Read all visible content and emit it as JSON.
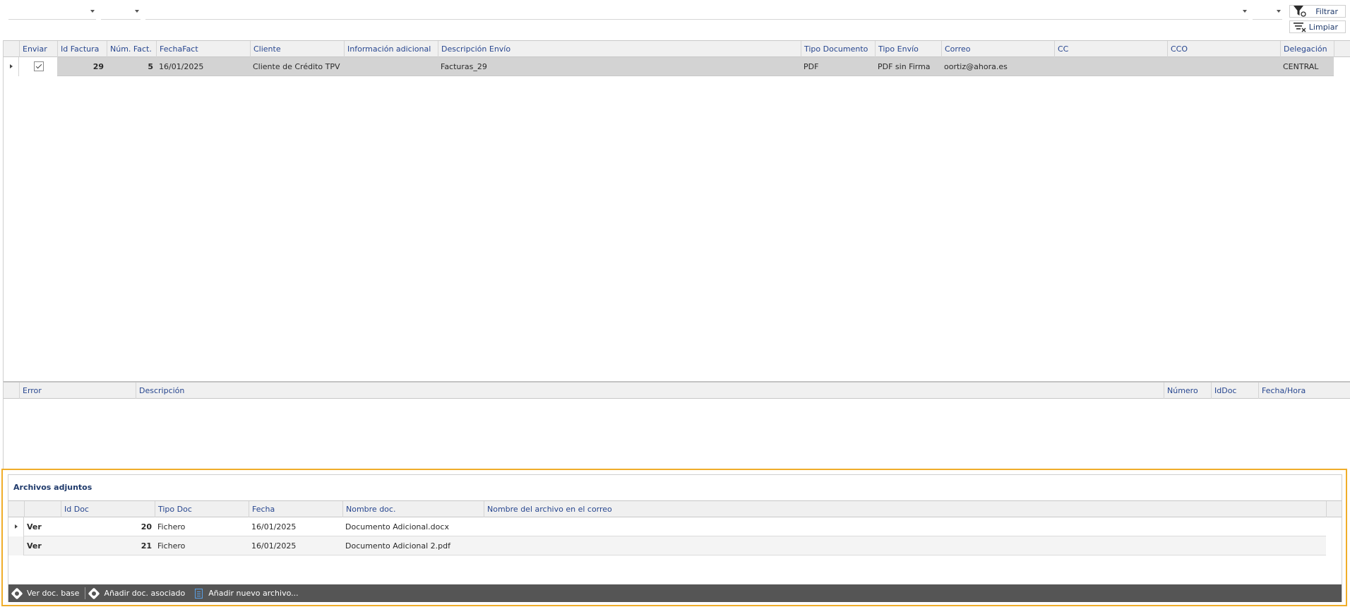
{
  "toolbar": {
    "filter_label": "Filtrar",
    "clear_label": "Limpiar"
  },
  "main_grid": {
    "columns": [
      "Enviar",
      "Id Factura",
      "Núm. Fact.",
      "FechaFact",
      "Cliente",
      "Información adicional",
      "Descripción Envío",
      "Tipo Documento",
      "Tipo Envío",
      "Correo",
      "CC",
      "CCO",
      "Delegación"
    ],
    "rows": [
      {
        "enviar": true,
        "id_factura": "29",
        "num_fact": "5",
        "fecha": "16/01/2025",
        "cliente": "Cliente de Crédito TPV",
        "info": "",
        "descripcion": "Facturas_29",
        "tipo_doc": "PDF",
        "tipo_envio": "PDF sin Firma",
        "correo": "oortiz@ahora.es",
        "cc": "",
        "cco": "",
        "delegacion": "CENTRAL"
      }
    ]
  },
  "error_grid": {
    "columns": [
      "Error",
      "Descripción",
      "Número",
      "IdDoc",
      "Fecha/Hora"
    ]
  },
  "attachments": {
    "title": "Archivos adjuntos",
    "columns": [
      "",
      "Id Doc",
      "Tipo Doc",
      "Fecha",
      "Nombre doc.",
      "Nombre del archivo en el correo"
    ],
    "rows": [
      {
        "action": "Ver",
        "id_doc": "20",
        "tipo": "Fichero",
        "fecha": "16/01/2025",
        "nombre": "Documento Adicional.docx",
        "nombre_correo": ""
      },
      {
        "action": "Ver",
        "id_doc": "21",
        "tipo": "Fichero",
        "fecha": "16/01/2025",
        "nombre": "Documento Adicional 2.pdf",
        "nombre_correo": ""
      }
    ],
    "toolbar": {
      "view_base": "Ver doc. base",
      "add_assoc": "Añadir doc. asociado",
      "add_new": "Añadir nuevo archivo..."
    }
  },
  "colors": {
    "highlight_border": "#f0ad29",
    "header_text": "#27468f",
    "toolbar_bg": "#555555",
    "selected_row": "#d3d3d3"
  }
}
